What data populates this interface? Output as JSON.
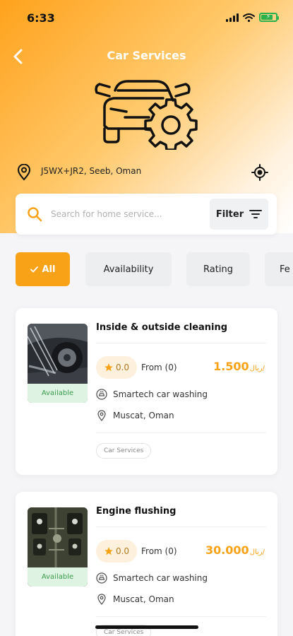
{
  "status_bar": {
    "time": "6:33"
  },
  "header": {
    "title": "Car Services",
    "location": "J5WX+JR2, Seeb, Oman"
  },
  "search": {
    "placeholder": "Search for home service...",
    "value": ""
  },
  "filter_label": "Filter",
  "chips": [
    "All",
    "Availability",
    "Rating",
    "Fe"
  ],
  "cards": [
    {
      "title": "Inside & outside cleaning",
      "availability": "Available",
      "rating": "0.0",
      "from": "From (0)",
      "price": "1.500",
      "currency": "ريال/",
      "provider": "Smartech car washing",
      "location": "Muscat, Oman",
      "tag": "Car Services"
    },
    {
      "title": "Engine flushing",
      "availability": "Available",
      "rating": "0.0",
      "from": "From (0)",
      "price": "30.000",
      "currency": "ريال/",
      "provider": "Smartech car washing",
      "location": "Muscat, Oman",
      "tag": "Car Services"
    }
  ],
  "colors": {
    "accent": "#f8a218",
    "available_bg": "#dff3e2",
    "available_text": "#3a9c4f",
    "battery": "#2bb24c"
  },
  "battery_level": 0.8,
  "icons": [
    "back-arrow-icon",
    "car-gear-icon",
    "location-pin-icon",
    "locate-target-icon",
    "search-icon",
    "filter-icon",
    "check-icon",
    "star-icon",
    "car-wash-icon",
    "signal-icon",
    "wifi-icon",
    "battery-icon"
  ]
}
